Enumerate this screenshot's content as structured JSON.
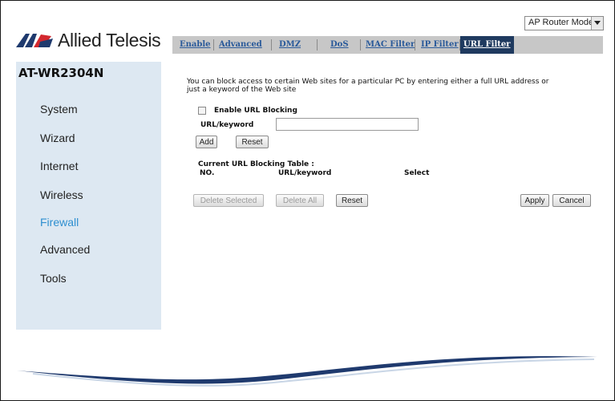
{
  "header": {
    "brand": "Allied Telesis",
    "mode_select": {
      "value": "AP Router Mode"
    }
  },
  "tabs": [
    {
      "label": "Enable",
      "active": false
    },
    {
      "label": "Advanced",
      "active": false
    },
    {
      "label": "DMZ",
      "active": false
    },
    {
      "label": "DoS",
      "active": false
    },
    {
      "label": "MAC Filter",
      "active": false
    },
    {
      "label": "IP Filter",
      "active": false
    },
    {
      "label": "URL Filter",
      "active": true
    }
  ],
  "sidebar": {
    "model": "AT-WR2304N",
    "items": [
      {
        "label": "System"
      },
      {
        "label": "Wizard"
      },
      {
        "label": "Internet"
      },
      {
        "label": "Wireless"
      },
      {
        "label": "Firewall",
        "active": true
      },
      {
        "label": "Advanced"
      },
      {
        "label": "Tools"
      }
    ]
  },
  "main": {
    "description_line1": "You can block access to certain Web sites for a particular PC by entering either a full URL address or",
    "description_line2": "just a keyword of the Web site",
    "enable_label": "Enable URL Blocking",
    "enable_checked": false,
    "url_label": "URL/keyword",
    "url_value": "",
    "add_button": "Add",
    "reset_button": "Reset",
    "table_title": "Current URL Blocking Table :",
    "columns": [
      "NO.",
      "URL/keyword",
      "Select"
    ],
    "delete_selected_button": "Delete Selected",
    "delete_all_button": "Delete All",
    "reset_button_2": "Reset",
    "apply_button": "Apply",
    "cancel_button": "Cancel"
  },
  "colors": {
    "tab_bar": "#c7c7c7",
    "tab_active_bg": "#1f3a5f",
    "tab_link": "#2a5a9a",
    "sidebar_bg": "#dde8f2",
    "nav_active": "#2e8fd0",
    "logo_red": "#d3282e",
    "logo_navy": "#1f3a6e"
  },
  "icons": {
    "logo": "allied-telesis-logo-icon",
    "dropdown": "chevron-down-icon",
    "checkbox": "checkbox-icon"
  }
}
